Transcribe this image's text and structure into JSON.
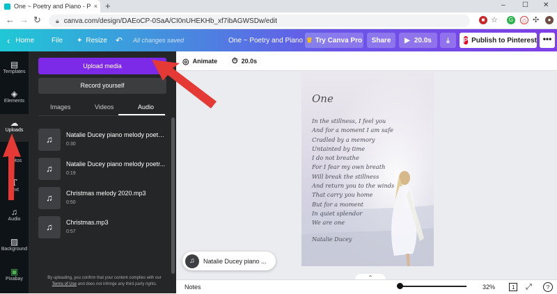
{
  "browser": {
    "tab_title": "One ~ Poetry and Piano - Pinterest",
    "tab_close": "×",
    "new_tab": "+",
    "url": "canva.com/design/DAEoCP-0SaA/CI0nUHEKHb_xf7ibAGWSDw/edit",
    "win_min": "–",
    "win_max": "☐",
    "win_close": "✕"
  },
  "header": {
    "home": "Home",
    "file": "File",
    "resize": "Resize",
    "saved_status": "All changes saved",
    "design_title": "One ~ Poetry and Piano",
    "try_pro": "Try Canva Pro",
    "share": "Share",
    "play_duration": "20.0s",
    "publish": "Publish to Pinterest",
    "more": "•••"
  },
  "rail": {
    "items": [
      {
        "label": "Templates",
        "icon": "▤"
      },
      {
        "label": "Elements",
        "icon": "◈"
      },
      {
        "label": "Uploads",
        "icon": "☁"
      },
      {
        "label": "otos",
        "icon": ""
      },
      {
        "label": "Text",
        "icon": "T"
      },
      {
        "label": "Audio",
        "icon": "♫"
      },
      {
        "label": "Background",
        "icon": "▨"
      },
      {
        "label": "Pixabay",
        "icon": "▣"
      }
    ]
  },
  "panel": {
    "upload_media": "Upload media",
    "record_yourself": "Record yourself",
    "tabs": [
      "Images",
      "Videos",
      "Audio"
    ],
    "files": [
      {
        "name": "Natalie Ducey piano melody poetry...",
        "duration": "0:30"
      },
      {
        "name": "Natalie Ducey piano melody poetr...",
        "duration": "0:19"
      },
      {
        "name": "Christmas melody 2020.mp3",
        "duration": "0:50"
      },
      {
        "name": "Christmas.mp3",
        "duration": "0:57"
      }
    ],
    "fine_print_1": "By uploading, you confirm that your content complies with our",
    "terms": "Terms of Use",
    "fine_print_2": "and does not infringe any third party rights."
  },
  "toolbar": {
    "animate": "Animate",
    "duration": "20.0s"
  },
  "design": {
    "title": "One",
    "lines": [
      "In the stillness, I feel you",
      "And for a moment I am safe",
      "Cradled by a memory",
      "Untainted by time",
      "I do not breathe",
      "For I fear my own breath",
      "Will break the stillness",
      "And return you to the winds",
      "That carry you home",
      "But for a moment",
      "In quiet splendor",
      "We are one"
    ],
    "author": "Natalie Ducey"
  },
  "audio_pill": {
    "label": "Natalie Ducey piano ..."
  },
  "footer": {
    "notes": "Notes",
    "zoom": "32%",
    "page": "1",
    "help": "?"
  },
  "colors": {
    "accent_purple": "#7d2ae8",
    "arrow_red": "#e53935",
    "pinterest_red": "#e60023"
  }
}
